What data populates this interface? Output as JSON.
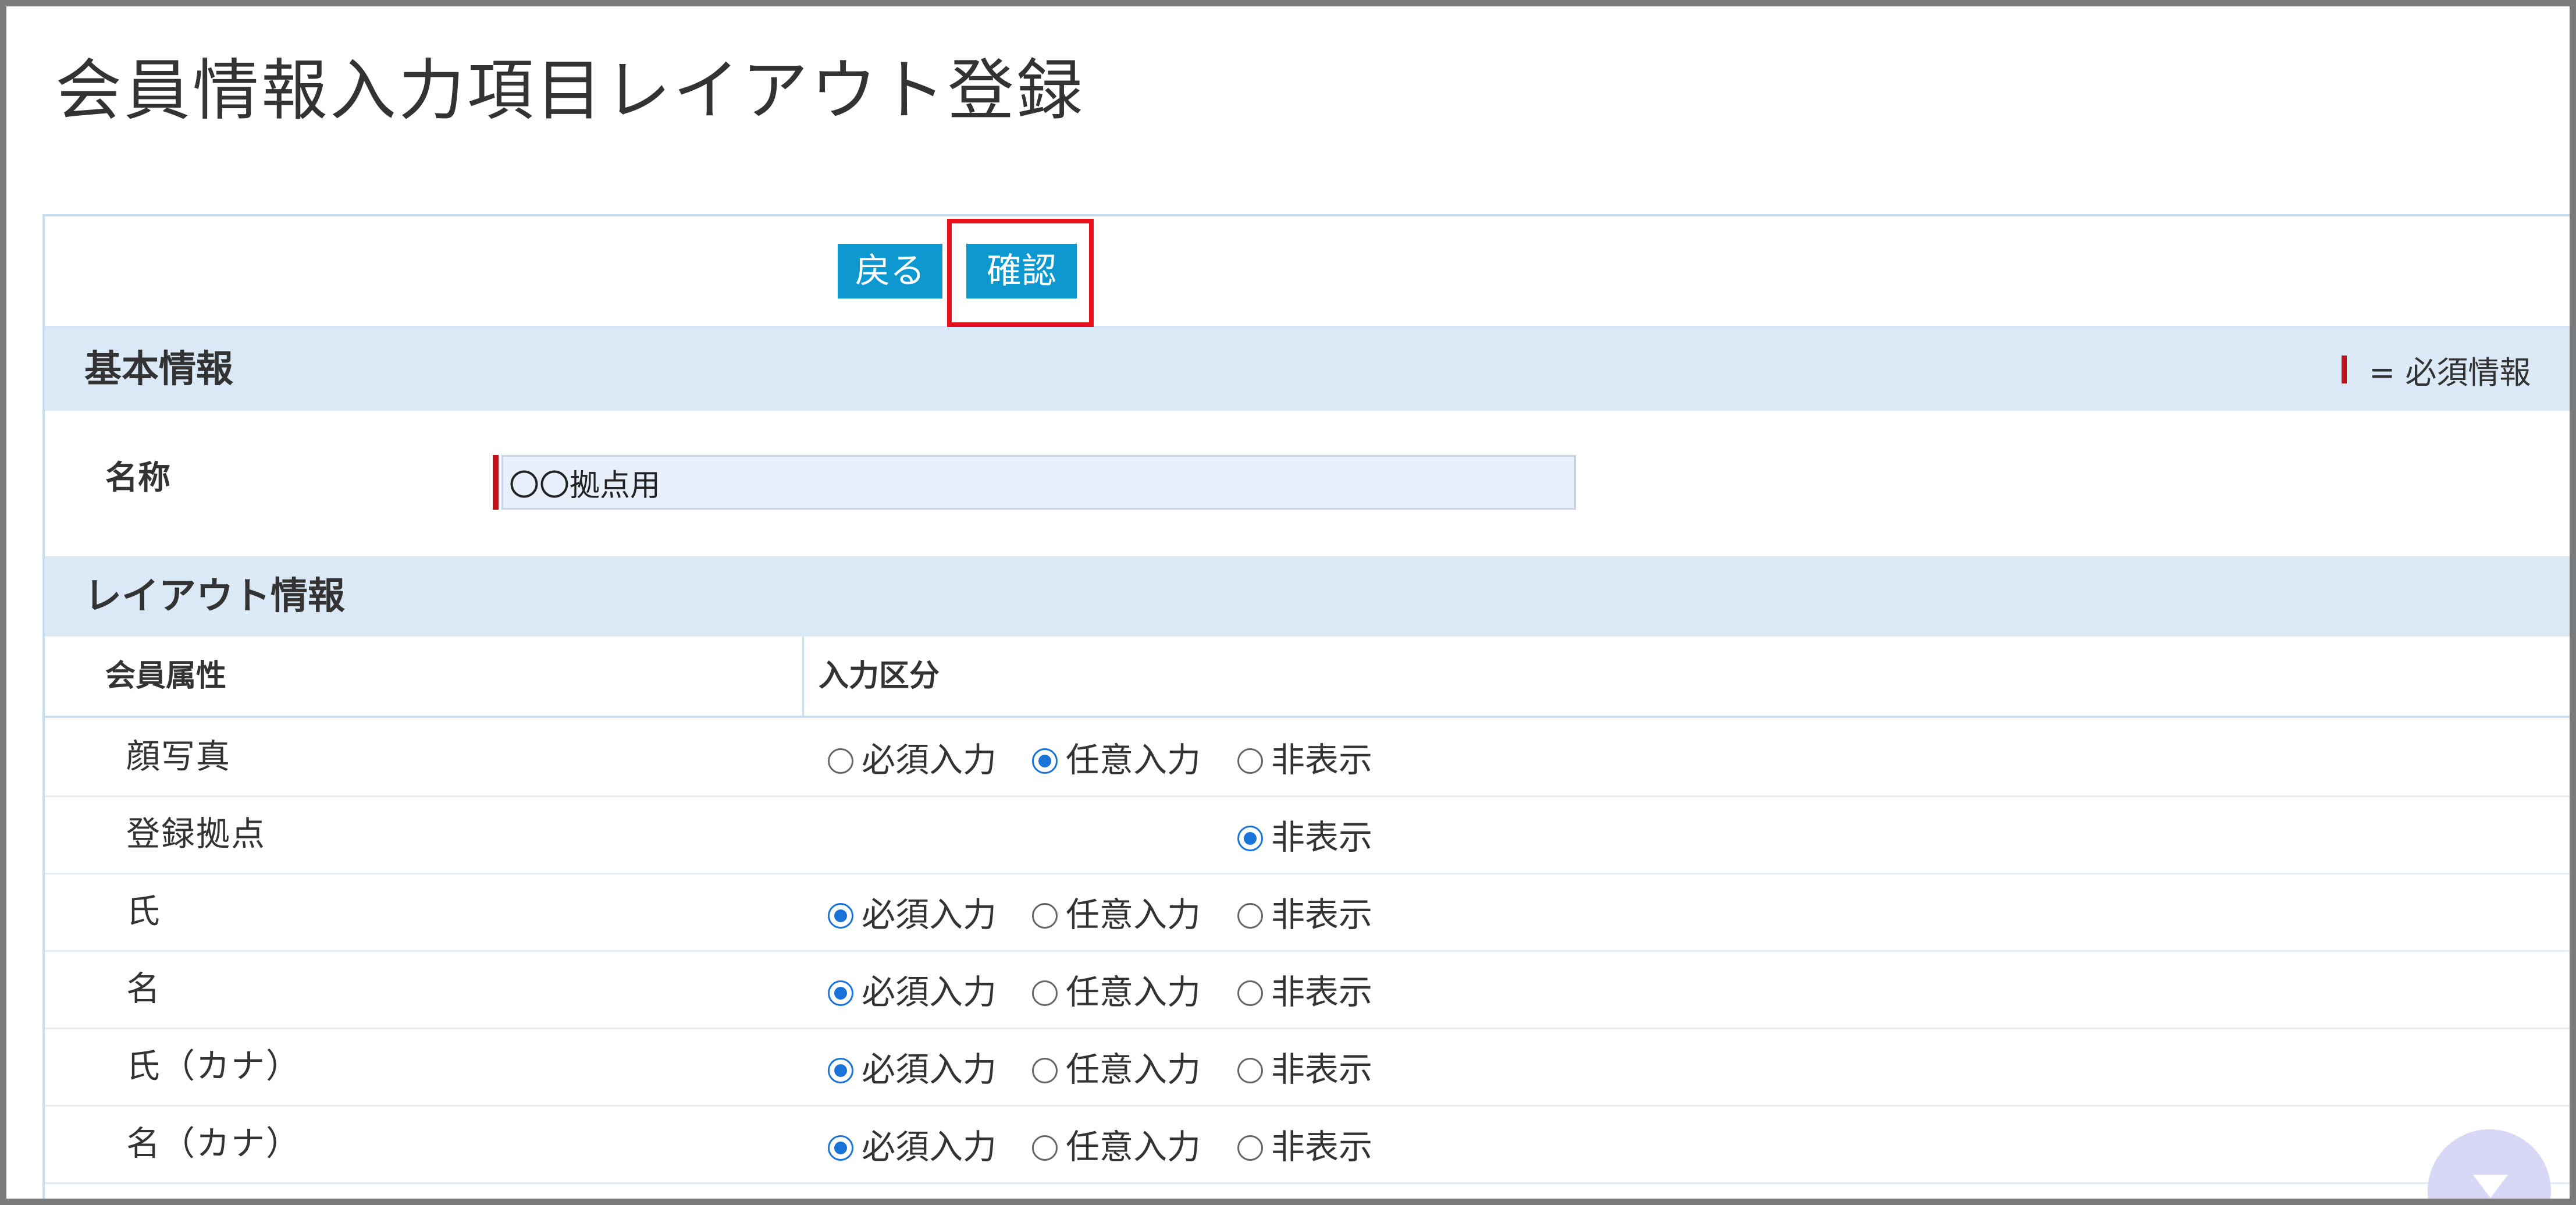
{
  "page": {
    "title": "会員情報入力項目レイアウト登録"
  },
  "toolbar": {
    "back_label": "戻る",
    "confirm_label": "確認"
  },
  "basic_section": {
    "title": "基本情報",
    "legend_text": "= 必須情報",
    "name_label": "名称",
    "name_value": "〇〇拠点用"
  },
  "layout_section": {
    "title": "レイアウト情報",
    "columns": {
      "attribute": "会員属性",
      "input_type": "入力区分"
    },
    "option_labels": {
      "required": "必須入力",
      "optional": "任意入力",
      "hidden": "非表示"
    },
    "rows": [
      {
        "label": "顔写真",
        "options": [
          "required",
          "optional",
          "hidden"
        ],
        "selected": "optional"
      },
      {
        "label": "登録拠点",
        "options": [
          "hidden"
        ],
        "selected": "hidden"
      },
      {
        "label": "氏",
        "options": [
          "required",
          "optional",
          "hidden"
        ],
        "selected": "required"
      },
      {
        "label": "名",
        "options": [
          "required",
          "optional",
          "hidden"
        ],
        "selected": "required"
      },
      {
        "label": "氏（カナ）",
        "options": [
          "required",
          "optional",
          "hidden"
        ],
        "selected": "required"
      },
      {
        "label": "名（カナ）",
        "options": [
          "required",
          "optional",
          "hidden"
        ],
        "selected": "required"
      }
    ]
  },
  "colors": {
    "button_bg": "#0e98d0",
    "section_bg": "#dbe9f7",
    "required_mark": "#c0101a",
    "highlight_border": "#e8101a",
    "radio_checked": "#1a73d9"
  },
  "icons": {
    "scroll_button": "chevron-down-icon"
  }
}
